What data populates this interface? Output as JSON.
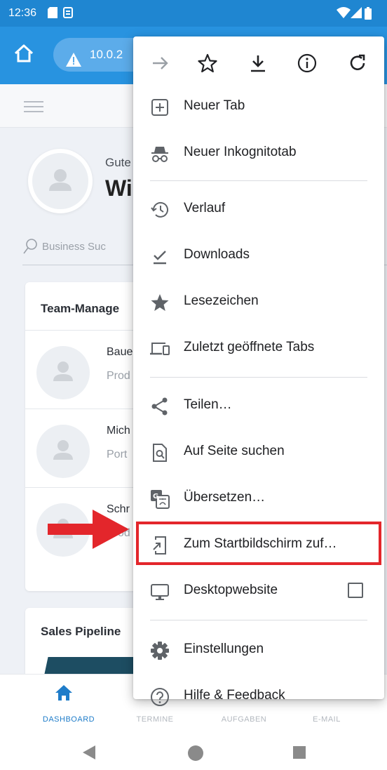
{
  "status_bar": {
    "time": "12:36"
  },
  "browser": {
    "url": "10.0.2"
  },
  "page": {
    "greeting_small": "Gute",
    "greeting_big": "Wi",
    "search_placeholder": "Business Suc",
    "team_card": {
      "title": "Team-Manage",
      "rows": [
        {
          "name": "Baue",
          "role": "Prod"
        },
        {
          "name": "Mich",
          "role": "Port"
        },
        {
          "name": "Schr",
          "role": "Prod"
        }
      ]
    },
    "sales_card": {
      "title": "Sales Pipeline"
    }
  },
  "bottom_nav": {
    "items": [
      {
        "label": "DASHBOARD",
        "active": true
      },
      {
        "label": "TERMINE",
        "active": false
      },
      {
        "label": "AUFGABEN",
        "active": false
      },
      {
        "label": "E-MAIL",
        "active": false
      }
    ]
  },
  "menu": {
    "top_actions": [
      "forward-icon",
      "star-icon",
      "download-icon",
      "info-icon",
      "refresh-icon"
    ],
    "items": [
      {
        "label": "Neuer Tab",
        "icon": "new-tab-icon"
      },
      {
        "label": "Neuer Inkognitotab",
        "icon": "incognito-icon"
      },
      {
        "label": "Verlauf",
        "icon": "history-icon"
      },
      {
        "label": "Downloads",
        "icon": "downloads-check-icon"
      },
      {
        "label": "Lesezeichen",
        "icon": "bookmarks-star-icon"
      },
      {
        "label": "Zuletzt geöffnete Tabs",
        "icon": "recent-tabs-icon"
      },
      {
        "label": "Teilen…",
        "icon": "share-icon"
      },
      {
        "label": "Auf Seite suchen",
        "icon": "find-in-page-icon"
      },
      {
        "label": "Übersetzen…",
        "icon": "translate-icon"
      },
      {
        "label": "Zum Startbildschirm zuf…",
        "icon": "add-to-homescreen-icon"
      },
      {
        "label": "Desktopwebsite",
        "icon": "desktop-icon",
        "checked": false
      },
      {
        "label": "Einstellungen",
        "icon": "settings-gear-icon"
      },
      {
        "label": "Hilfe & Feedback",
        "icon": "help-icon"
      }
    ]
  },
  "colors": {
    "status_bar": "#1f86d1",
    "toolbar": "#2893e0",
    "accent": "#1e7cc9",
    "highlight": "#e3262b"
  }
}
